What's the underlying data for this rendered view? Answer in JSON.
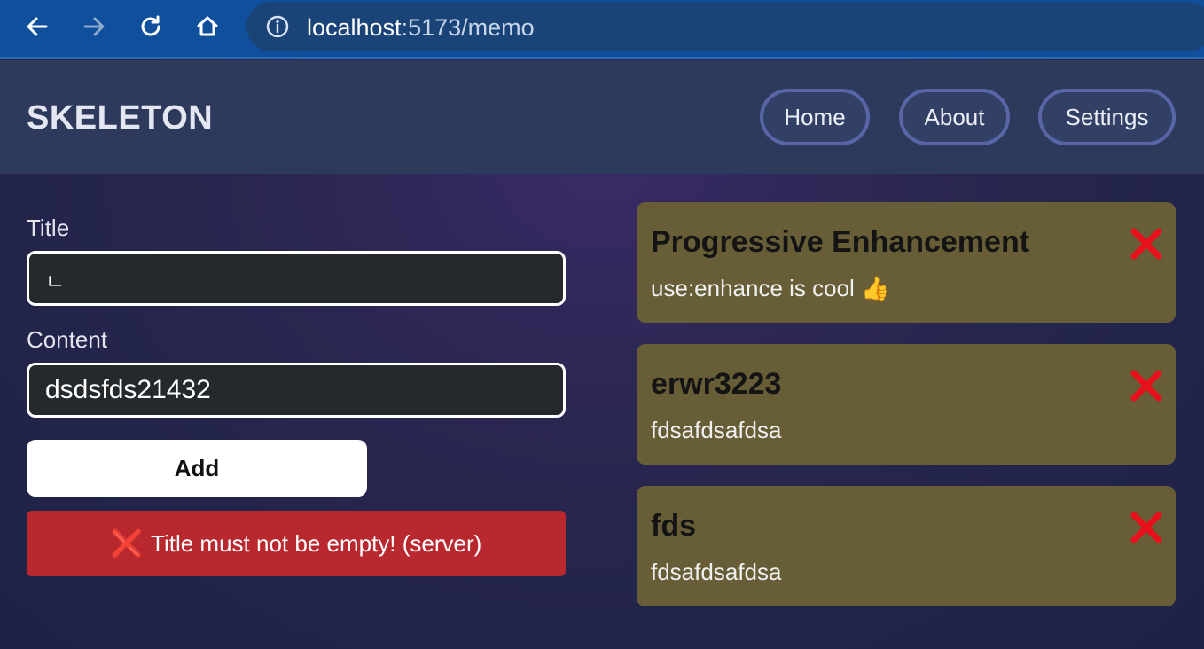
{
  "browser": {
    "url_host": "localhost",
    "url_path": ":5173/memo"
  },
  "app": {
    "brand": "SKELETON",
    "nav": [
      {
        "label": "Home"
      },
      {
        "label": "About"
      },
      {
        "label": "Settings"
      }
    ]
  },
  "form": {
    "title_label": "Title",
    "title_value": "ㄴ",
    "content_label": "Content",
    "content_value": "dsdsfds21432",
    "add_label": "Add",
    "error_icon": "❌",
    "error_text": "Title must not be empty! (server)"
  },
  "memos": [
    {
      "title": "Progressive Enhancement",
      "content": "use:enhance is cool 👍"
    },
    {
      "title": "erwr3223",
      "content": "fdsafdsafdsa"
    },
    {
      "title": "fds",
      "content": "fdsafdsafdsa"
    }
  ],
  "colors": {
    "card_bg": "#675e37",
    "error_bg": "#b8282e",
    "delete_x": "#e8101a"
  }
}
